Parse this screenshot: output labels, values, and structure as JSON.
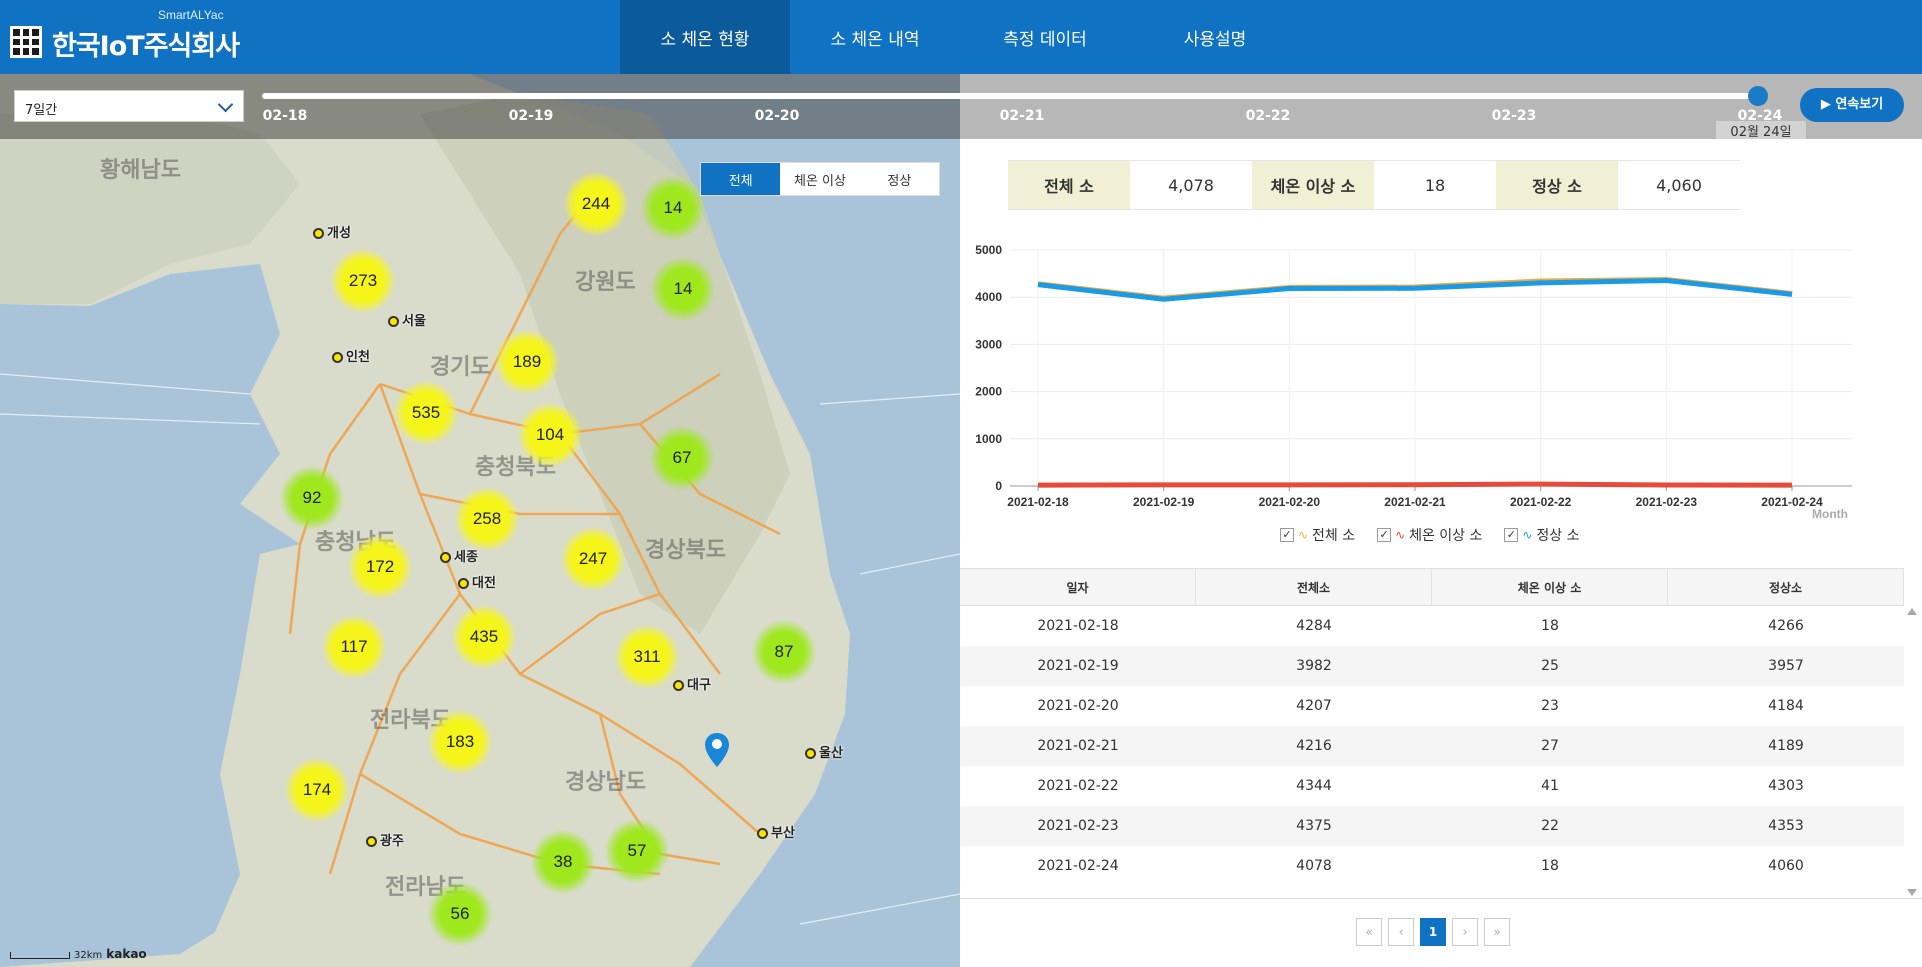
{
  "header": {
    "brand_sub": "SmartALYac",
    "brand_name": "한국IoT주식회사",
    "nav": [
      "소 체온 현황",
      "소 체온 내역",
      "측정 데이터",
      "사용설명"
    ]
  },
  "timeline": {
    "period": "7일간",
    "dates": [
      "02-18",
      "02-19",
      "02-20",
      "02-21",
      "02-22",
      "02-23",
      "02-24"
    ],
    "current_date": "02월 24일",
    "play_label": "연속보기"
  },
  "filter": [
    "전체",
    "체온 이상",
    "정상"
  ],
  "map": {
    "clusters": [
      {
        "value": "244",
        "color": "yellow"
      },
      {
        "value": "14",
        "color": "green"
      },
      {
        "value": "273",
        "color": "yellow"
      },
      {
        "value": "14",
        "color": "green"
      },
      {
        "value": "189",
        "color": "yellow"
      },
      {
        "value": "535",
        "color": "yellow"
      },
      {
        "value": "104",
        "color": "yellow"
      },
      {
        "value": "67",
        "color": "green"
      },
      {
        "value": "92",
        "color": "green"
      },
      {
        "value": "258",
        "color": "yellow"
      },
      {
        "value": "172",
        "color": "yellow"
      },
      {
        "value": "247",
        "color": "yellow"
      },
      {
        "value": "117",
        "color": "yellow"
      },
      {
        "value": "435",
        "color": "yellow"
      },
      {
        "value": "311",
        "color": "yellow"
      },
      {
        "value": "87",
        "color": "green"
      },
      {
        "value": "183",
        "color": "yellow"
      },
      {
        "value": "174",
        "color": "yellow"
      },
      {
        "value": "38",
        "color": "green"
      },
      {
        "value": "57",
        "color": "green"
      },
      {
        "value": "56",
        "color": "green"
      }
    ],
    "places": [
      "개성",
      "서울",
      "인천",
      "세종",
      "대전",
      "대구",
      "울산",
      "부산",
      "광주"
    ],
    "regions": [
      "황해남도",
      "강원도",
      "경기도",
      "충청북도",
      "충청남도",
      "경상북도",
      "전라북도",
      "경상남도",
      "전라남도"
    ],
    "scale": "32km",
    "provider": "kakao"
  },
  "summary": [
    {
      "label": "전체 소",
      "value": "4,078"
    },
    {
      "label": "체온 이상 소",
      "value": "18"
    },
    {
      "label": "정상 소",
      "value": "4,060"
    }
  ],
  "chart_data": {
    "type": "line",
    "categories": [
      "2021-02-18",
      "2021-02-19",
      "2021-02-20",
      "2021-02-21",
      "2021-02-22",
      "2021-02-23",
      "2021-02-24"
    ],
    "series": [
      {
        "name": "전체 소",
        "values": [
          4284,
          3982,
          4207,
          4216,
          4344,
          4375,
          4078
        ],
        "color": "#f2a93b"
      },
      {
        "name": "체온 이상 소",
        "values": [
          18,
          25,
          23,
          27,
          41,
          22,
          18
        ],
        "color": "#e64a3b"
      },
      {
        "name": "정상 소",
        "values": [
          4266,
          3957,
          4184,
          4189,
          4303,
          4353,
          4060
        ],
        "color": "#1a9be6"
      }
    ],
    "ylim": [
      0,
      5000
    ],
    "yticks": [
      "0",
      "1000",
      "2000",
      "3000",
      "4000",
      "5000"
    ],
    "xlabel": "Month",
    "grid": true,
    "legend": "bottom"
  },
  "table": {
    "headers": [
      "일자",
      "전체소",
      "체온 이상 소",
      "정상소"
    ],
    "rows": [
      [
        "2021-02-18",
        "4284",
        "18",
        "4266"
      ],
      [
        "2021-02-19",
        "3982",
        "25",
        "3957"
      ],
      [
        "2021-02-20",
        "4207",
        "23",
        "4184"
      ],
      [
        "2021-02-21",
        "4216",
        "27",
        "4189"
      ],
      [
        "2021-02-22",
        "4344",
        "41",
        "4303"
      ],
      [
        "2021-02-23",
        "4375",
        "22",
        "4353"
      ],
      [
        "2021-02-24",
        "4078",
        "18",
        "4060"
      ]
    ]
  },
  "pager": {
    "current": "1"
  }
}
